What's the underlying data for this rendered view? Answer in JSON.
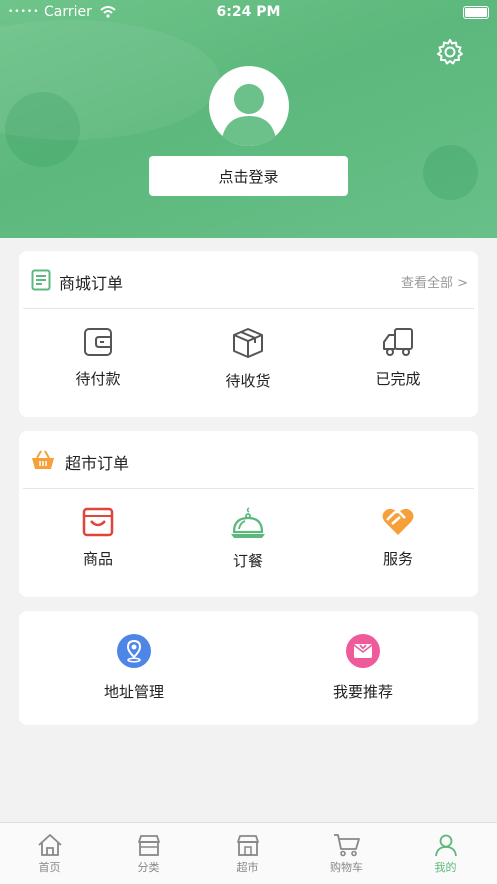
{
  "status_bar": {
    "carrier": "Carrier",
    "time": "6:24 PM"
  },
  "header": {
    "login_label": "点击登录"
  },
  "mall_orders": {
    "title": "商城订单",
    "view_all": "查看全部 >",
    "items": [
      {
        "label": "待付款",
        "icon": "wallet-icon"
      },
      {
        "label": "待收货",
        "icon": "package-icon"
      },
      {
        "label": "已完成",
        "icon": "truck-icon"
      }
    ]
  },
  "supermarket_orders": {
    "title": "超市订单",
    "items": [
      {
        "label": "商品",
        "icon": "shopping-bag-icon"
      },
      {
        "label": "订餐",
        "icon": "food-cloche-icon"
      },
      {
        "label": "服务",
        "icon": "service-heart-icon"
      }
    ]
  },
  "services": {
    "items": [
      {
        "label": "地址管理",
        "icon": "location-pin-icon"
      },
      {
        "label": "我要推荐",
        "icon": "recommend-icon"
      }
    ]
  },
  "tabbar": {
    "items": [
      {
        "label": "首页",
        "icon": "home-icon"
      },
      {
        "label": "分类",
        "icon": "category-icon"
      },
      {
        "label": "超市",
        "icon": "store-icon"
      },
      {
        "label": "购物车",
        "icon": "cart-icon"
      },
      {
        "label": "我的",
        "icon": "profile-icon"
      }
    ],
    "active_index": 4
  },
  "colors": {
    "primary": "#5cb87c",
    "accent_orange": "#f5a03b",
    "accent_red": "#e0453a",
    "accent_blue": "#4e86e8",
    "accent_pink": "#ee5a9a"
  }
}
